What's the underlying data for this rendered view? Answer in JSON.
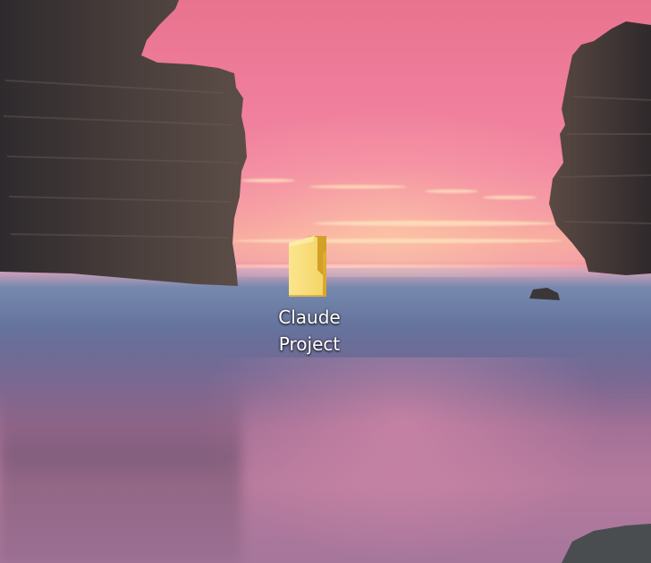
{
  "desktop": {
    "wallpaper": "sunset-sea-stacks",
    "icons": [
      {
        "label": "Claude Project",
        "icon": "folder-icon",
        "folder_color": "#f4d567"
      }
    ]
  }
}
